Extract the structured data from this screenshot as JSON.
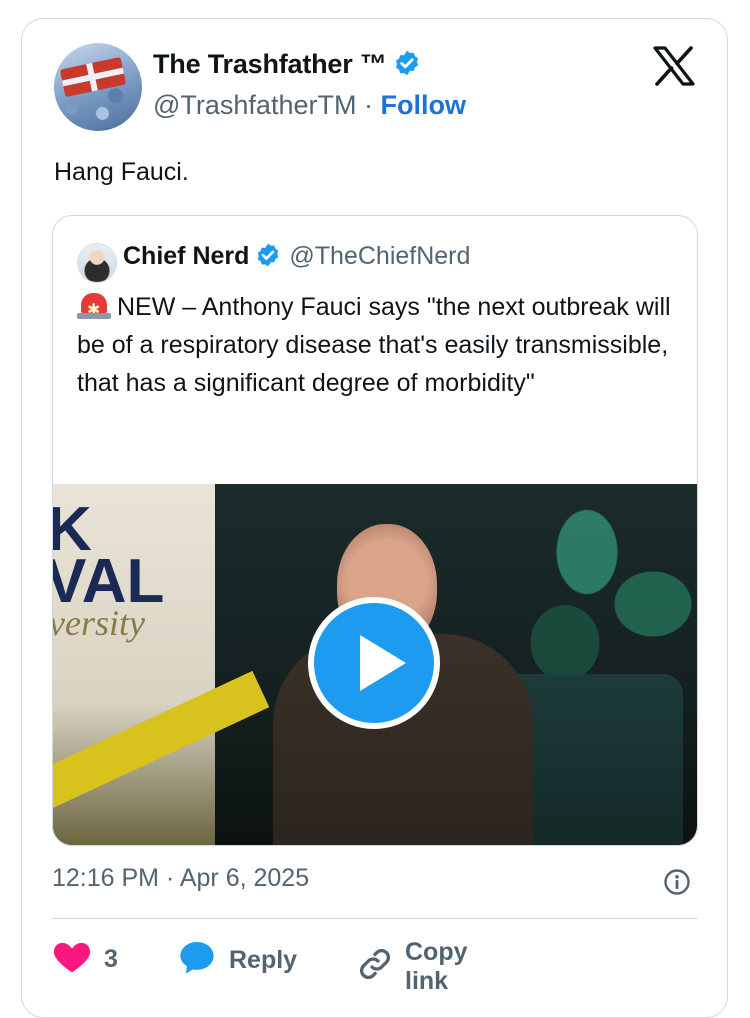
{
  "tweet": {
    "author": {
      "display_name": "The Trashfather ™",
      "handle": "@TrashfatherTM",
      "separator": "·",
      "follow_label": "Follow",
      "verified": true
    },
    "text": "Hang Fauci.",
    "quoted": {
      "display_name": "Chief Nerd",
      "handle": "@TheChiefNerd",
      "verified": true,
      "icon": "rotating-light-emoji",
      "text": "NEW – Anthony Fauci says \"the next outbreak will be of a respiratory disease that's easily transmissible, that has a significant degree of morbidity\"",
      "banner_text_1": "K",
      "banner_text_2": "VAL",
      "banner_text_3": "versity"
    },
    "timestamp": "12:16 PM · Apr 6, 2025",
    "actions": {
      "like_count": "3",
      "reply_label": "Reply",
      "copy_link_label": "Copy link"
    }
  },
  "colors": {
    "accent_blue": "#1d9bf0",
    "follow_blue": "#1d74d6",
    "like_pink": "#f91880",
    "muted_text": "#536471",
    "border": "#cfd9de"
  },
  "icons": [
    "x-logo-icon",
    "verified-badge-icon",
    "play-icon",
    "info-icon",
    "heart-icon",
    "reply-bubble-icon",
    "link-icon"
  ]
}
